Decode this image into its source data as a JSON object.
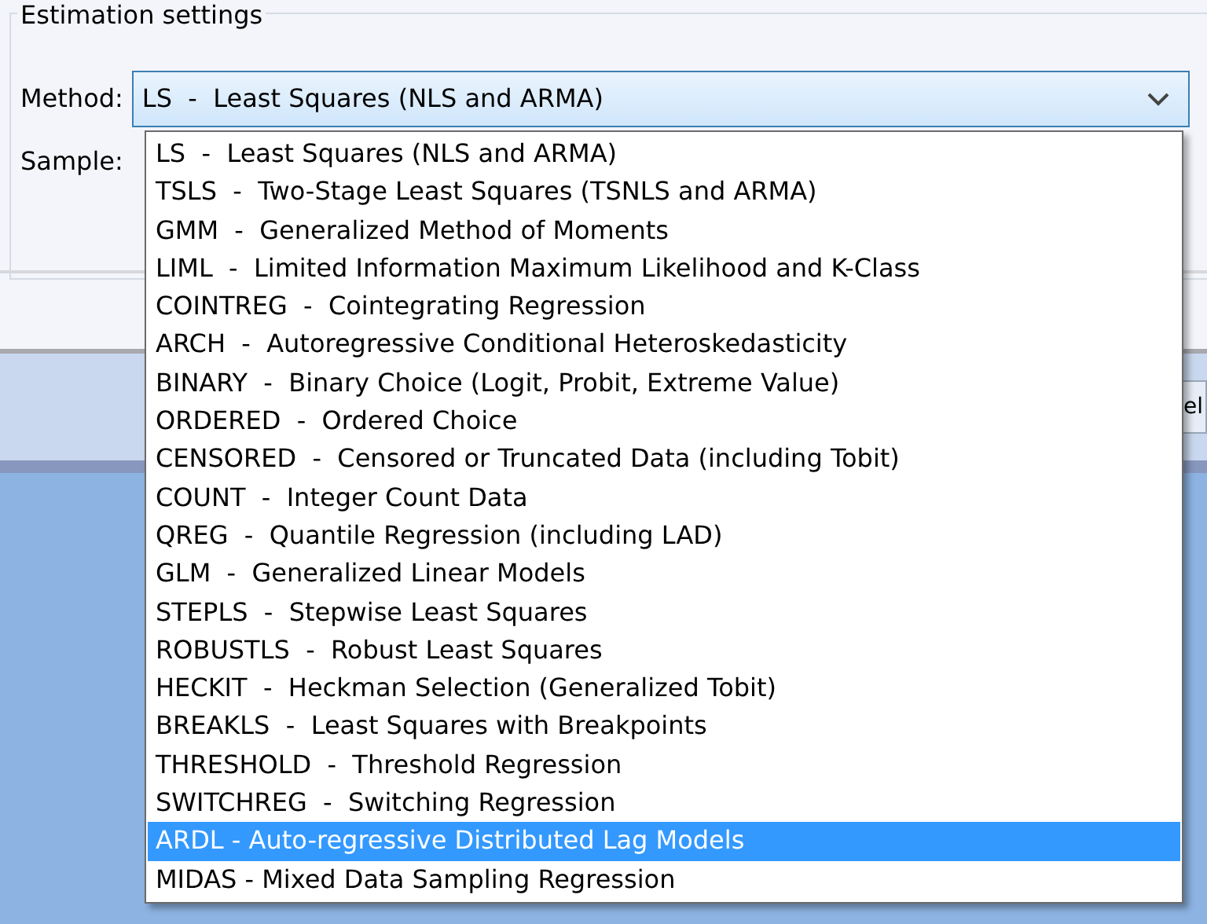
{
  "group": {
    "title": "Estimation settings"
  },
  "method": {
    "label": "Method:",
    "value": "LS  -  Least Squares (NLS and ARMA)",
    "expanded": true
  },
  "sample": {
    "label": "Sample:"
  },
  "dropdown_items": [
    {
      "text": "LS  -  Least Squares (NLS and ARMA)",
      "selected": false
    },
    {
      "text": "TSLS  -  Two-Stage Least Squares (TSNLS and ARMA)",
      "selected": false
    },
    {
      "text": "GMM  -  Generalized Method of Moments",
      "selected": false
    },
    {
      "text": "LIML  -  Limited Information Maximum Likelihood and K-Class",
      "selected": false
    },
    {
      "text": "COINTREG  -  Cointegrating Regression",
      "selected": false
    },
    {
      "text": "ARCH  -  Autoregressive Conditional Heteroskedasticity",
      "selected": false
    },
    {
      "text": "BINARY  -  Binary Choice (Logit, Probit, Extreme Value)",
      "selected": false
    },
    {
      "text": "ORDERED  -  Ordered Choice",
      "selected": false
    },
    {
      "text": "CENSORED  -  Censored or Truncated Data (including Tobit)",
      "selected": false
    },
    {
      "text": "COUNT  -  Integer Count Data",
      "selected": false
    },
    {
      "text": "QREG  -  Quantile Regression (including LAD)",
      "selected": false
    },
    {
      "text": "GLM  -  Generalized Linear Models",
      "selected": false
    },
    {
      "text": "STEPLS  -  Stepwise Least Squares",
      "selected": false
    },
    {
      "text": "ROBUSTLS  -  Robust Least Squares",
      "selected": false
    },
    {
      "text": "HECKIT  -  Heckman Selection (Generalized Tobit)",
      "selected": false
    },
    {
      "text": "BREAKLS  -  Least Squares with Breakpoints",
      "selected": false
    },
    {
      "text": "THRESHOLD  -  Threshold Regression",
      "selected": false
    },
    {
      "text": "SWITCHREG  -  Switching Regression",
      "selected": false
    },
    {
      "text": "ARDL - Auto-regressive Distributed Lag Models",
      "selected": true
    },
    {
      "text": "MIDAS - Mixed Data Sampling Regression",
      "selected": false
    }
  ],
  "cut_button": {
    "label": "el"
  }
}
